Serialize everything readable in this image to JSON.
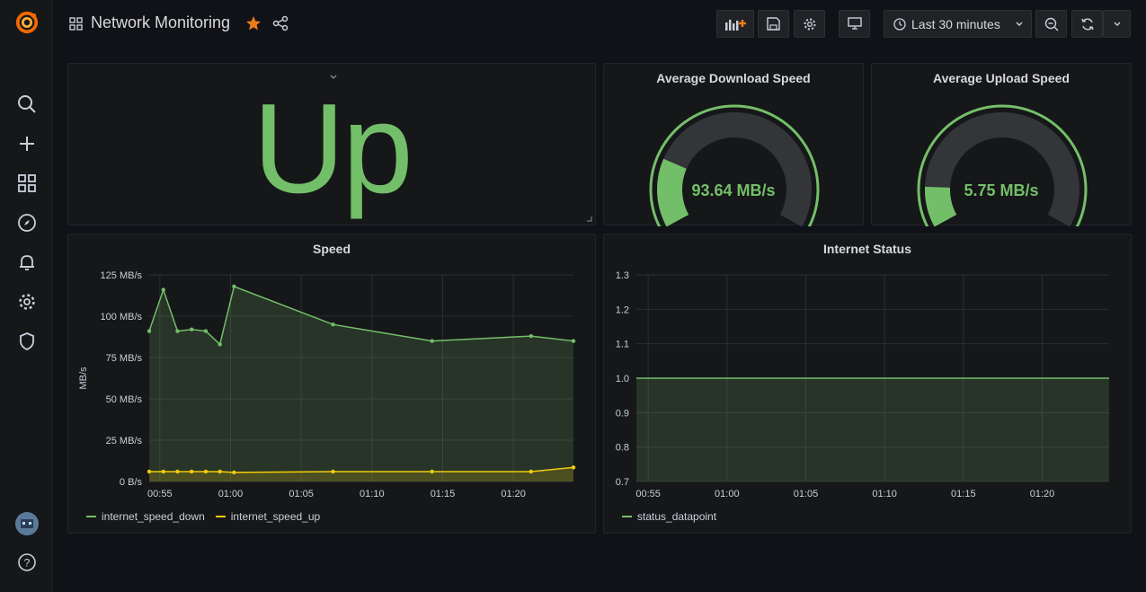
{
  "dashboard": {
    "title": "Network Monitoring"
  },
  "sidebar": {
    "items": [
      "grafana-logo",
      "search-icon",
      "plus-icon",
      "dashboards-icon",
      "explore-icon",
      "alert-bell-icon",
      "gear-icon",
      "shield-icon"
    ],
    "help": "?"
  },
  "toolbar": {
    "time_range": "Last 30 minutes"
  },
  "status_panel": {
    "value": "Up",
    "color": "#73bf69"
  },
  "gauges": [
    {
      "title": "Average Download Speed",
      "value_text": "93.64 MB/s",
      "fraction": 0.22,
      "color": "#73bf69"
    },
    {
      "title": "Average Upload Speed",
      "value_text": "5.75 MB/s",
      "fraction": 0.13,
      "color": "#73bf69"
    }
  ],
  "speed_panel": {
    "title": "Speed",
    "legend": [
      {
        "name": "internet_speed_down",
        "color": "#73bf69"
      },
      {
        "name": "internet_speed_up",
        "color": "#f2cc0c"
      }
    ]
  },
  "status_chart_panel": {
    "title": "Internet Status",
    "legend": [
      {
        "name": "status_datapoint",
        "color": "#73bf69"
      }
    ]
  },
  "chart_data": [
    {
      "type": "area",
      "title": "Speed",
      "ylabel": "MB/s",
      "xlabel": "",
      "ylim": [
        0,
        125
      ],
      "yticks": [
        "0 B/s",
        "25 MB/s",
        "50 MB/s",
        "75 MB/s",
        "100 MB/s",
        "125 MB/s"
      ],
      "xticks": [
        "00:55",
        "01:00",
        "01:05",
        "01:10",
        "01:15",
        "01:20"
      ],
      "xlim": [
        "00:54:15",
        "01:24:15"
      ],
      "grid": true,
      "legend": "bottom-left",
      "series": [
        {
          "name": "internet_speed_down",
          "color": "#73bf69",
          "x": [
            "00:54:15",
            "00:55:15",
            "00:56:15",
            "00:57:15",
            "00:58:15",
            "00:59:15",
            "01:00:15",
            "01:07:15",
            "01:14:15",
            "01:21:15",
            "01:24:15"
          ],
          "values": [
            91,
            116,
            91,
            92,
            91,
            83,
            118,
            95,
            85,
            88,
            85
          ]
        },
        {
          "name": "internet_speed_up",
          "color": "#f2cc0c",
          "x": [
            "00:54:15",
            "00:55:15",
            "00:56:15",
            "00:57:15",
            "00:58:15",
            "00:59:15",
            "01:00:15",
            "01:07:15",
            "01:14:15",
            "01:21:15",
            "01:24:15"
          ],
          "values": [
            6,
            6,
            6,
            6,
            6,
            6,
            5.5,
            6,
            6,
            6,
            8.5
          ]
        }
      ]
    },
    {
      "type": "area",
      "title": "Internet Status",
      "ylabel": "",
      "xlabel": "",
      "ylim": [
        0.7,
        1.3
      ],
      "yticks": [
        "0.7",
        "0.8",
        "0.9",
        "1.0",
        "1.1",
        "1.2",
        "1.3"
      ],
      "xticks": [
        "00:55",
        "01:00",
        "01:05",
        "01:10",
        "01:15",
        "01:20"
      ],
      "xlim": [
        "00:54:15",
        "01:24:15"
      ],
      "grid": true,
      "legend": "bottom-left",
      "series": [
        {
          "name": "status_datapoint",
          "color": "#73bf69",
          "x": [
            "00:54:15",
            "01:24:15"
          ],
          "values": [
            1.0,
            1.0
          ]
        }
      ]
    }
  ]
}
